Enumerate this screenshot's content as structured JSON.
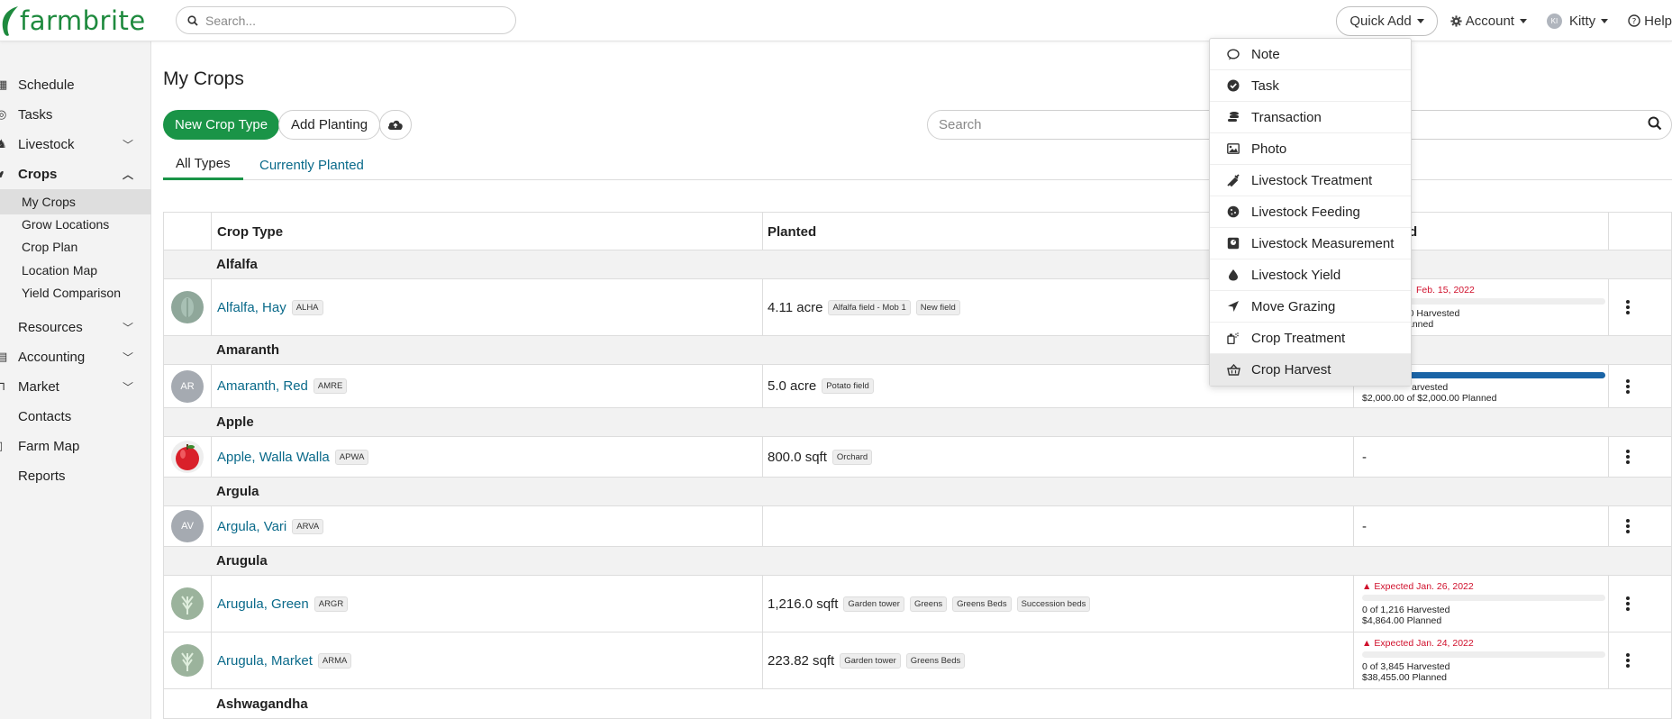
{
  "brand": {
    "name": "farmbrite",
    "color": "#1a9447"
  },
  "header": {
    "search_placeholder": "Search...",
    "quick_add": "Quick Add",
    "account": "Account",
    "user_initials": "KI",
    "user": "Kitty",
    "help": "Help"
  },
  "quick_add_menu": [
    {
      "label": "Note",
      "icon": "comment-icon"
    },
    {
      "label": "Task",
      "icon": "check-circle-icon"
    },
    {
      "label": "Transaction",
      "icon": "coins-icon"
    },
    {
      "label": "Photo",
      "icon": "image-icon"
    },
    {
      "label": "Livestock Treatment",
      "icon": "syringe-icon"
    },
    {
      "label": "Livestock Feeding",
      "icon": "cookie-icon"
    },
    {
      "label": "Livestock Measurement",
      "icon": "weight-icon"
    },
    {
      "label": "Livestock Yield",
      "icon": "droplet-icon"
    },
    {
      "label": "Move Grazing",
      "icon": "location-arrow-icon"
    },
    {
      "label": "Crop Treatment",
      "icon": "spray-can-icon"
    },
    {
      "label": "Crop Harvest",
      "icon": "basket-icon"
    }
  ],
  "sidebar": {
    "items": [
      {
        "label": "Schedule"
      },
      {
        "label": "Tasks"
      },
      {
        "label": "Livestock"
      },
      {
        "label": "Crops"
      },
      {
        "label": "Resources"
      },
      {
        "label": "Accounting"
      },
      {
        "label": "Market"
      },
      {
        "label": "Contacts"
      },
      {
        "label": "Farm Map"
      },
      {
        "label": "Reports"
      }
    ],
    "crops_sub": [
      {
        "label": "My Crops"
      },
      {
        "label": "Grow Locations"
      },
      {
        "label": "Crop Plan"
      },
      {
        "label": "Location Map"
      },
      {
        "label": "Yield Comparison"
      }
    ]
  },
  "main": {
    "title": "My Crops",
    "new_crop_type": "New Crop Type",
    "add_planting": "Add Planting",
    "search_placeholder": "Search",
    "tabs": [
      "All Types",
      "Currently Planted"
    ],
    "columns": {
      "crop_type": "Crop Type",
      "planted": "Planted",
      "harvested_partial": "d"
    }
  },
  "rows": {
    "alfalfa_group": "Alfalfa",
    "alfalfa_hay": {
      "name": "Alfalfa, Hay",
      "code": "ALHA",
      "planted": "4.11 acre",
      "tags": [
        "Alfalfa field - Mob 1",
        "New field"
      ],
      "expected_partial": "Feb. 15, 2022",
      "harvested_partial": "of 0 Harvested",
      "planned_partial": "anned"
    },
    "amaranth_group": "Amaranth",
    "amaranth_red": {
      "name": "Amaranth, Red",
      "code": "AMRE",
      "initials": "AR",
      "planted": "5.0 acre",
      "tags": [
        "Potato field"
      ],
      "harvested_partial": "arvested",
      "progress": 1.0,
      "planned": "$2,000.00 of $2,000.00 Planned"
    },
    "apple_group": "Apple",
    "apple_walla": {
      "name": "Apple, Walla Walla",
      "code": "APWA",
      "planted": "800.0 sqft",
      "tags": [
        "Orchard"
      ],
      "harvest": "-"
    },
    "argula_group": "Argula",
    "argula_vari": {
      "name": "Argula, Vari",
      "code": "ARVA",
      "initials": "AV",
      "harvest": "-"
    },
    "arugula_group": "Arugula",
    "arugula_green": {
      "name": "Arugula, Green",
      "code": "ARGR",
      "planted": "1,216.0 sqft",
      "tags": [
        "Garden tower",
        "Greens",
        "Greens Beds",
        "Succession beds"
      ],
      "expected": "Expected Jan. 26, 2022",
      "harvested": "0 of 1,216 Harvested",
      "planned": "$4,864.00 Planned",
      "progress": 0
    },
    "arugula_market": {
      "name": "Arugula, Market",
      "code": "ARMA",
      "planted": "223.82 sqft",
      "tags": [
        "Garden tower",
        "Greens Beds"
      ],
      "expected": "Expected Jan. 24, 2022",
      "harvested": "0 of 3,845 Harvested",
      "planned": "$38,455.00 Planned",
      "progress": 0
    },
    "ashwagandha_group": "Ashwagandha"
  }
}
